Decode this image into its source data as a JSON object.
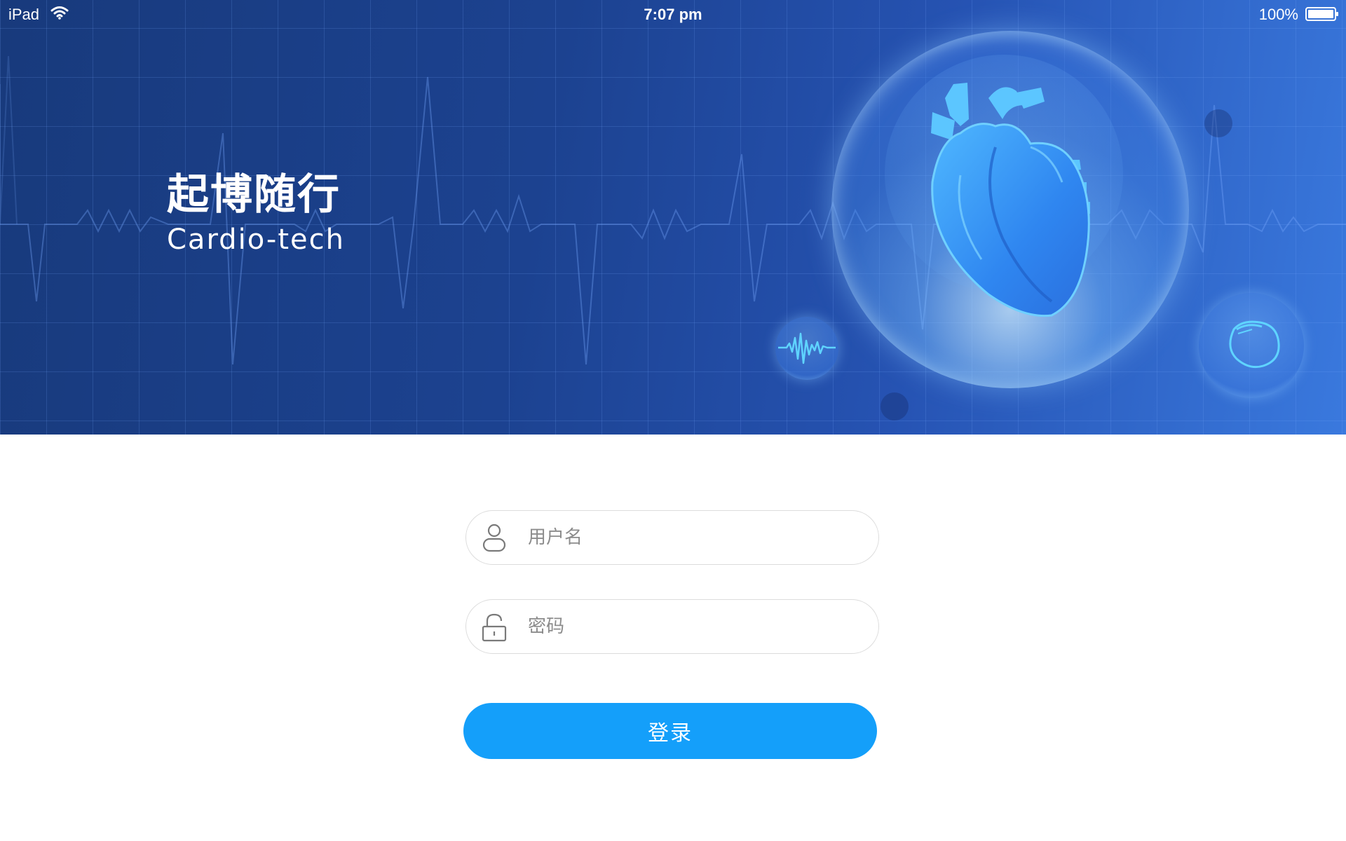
{
  "status_bar": {
    "device": "iPad",
    "time": "7:07 pm",
    "battery": "100%",
    "wifi_icon": "wifi-icon",
    "battery_icon": "battery-full-icon"
  },
  "hero": {
    "title": "起博随行",
    "subtitle": "Cardio-tech",
    "colors": {
      "background_left": "#183a7c",
      "background_right": "#3a79de"
    },
    "illustrations": [
      "heart-icon",
      "ecg-wave-icon",
      "pacemaker-icon"
    ]
  },
  "login": {
    "username": {
      "placeholder": "用户名",
      "value": "",
      "icon": "user-icon"
    },
    "password": {
      "placeholder": "密码",
      "value": "",
      "icon": "lock-icon"
    },
    "submit_label": "登录",
    "accent_color": "#149ffa"
  }
}
